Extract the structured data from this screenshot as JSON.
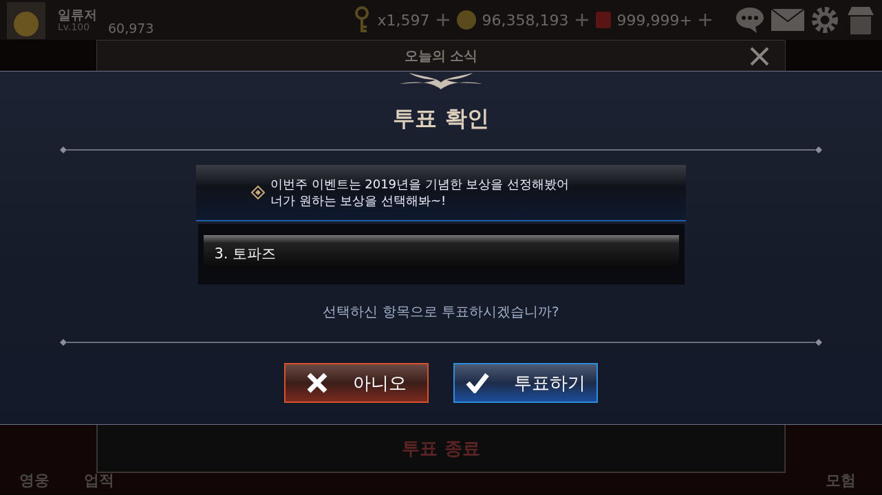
{
  "top_bar": {
    "player_name": "일류저",
    "level": "Lv.100",
    "score": "60,973",
    "keys": "x1,597",
    "coins": "96,358,193",
    "gems": "999,999+"
  },
  "news_panel": {
    "title": "오늘의 소식",
    "footer_button": "투표 종료"
  },
  "bottom_nav": [
    {
      "label": "영웅"
    },
    {
      "label": "업적"
    },
    {
      "label": "모험"
    }
  ],
  "dialog": {
    "title": "투표 확인",
    "message": [
      "이번주 이벤트는 2019년을 기념한 보상을 선정해봤어",
      "너가 원하는 보상을 선택해봐~!"
    ],
    "selected_option": "3. 토파즈",
    "question": "선택하신 항목으로 투표하시겠습니까?",
    "buttons": [
      {
        "label": "아니오",
        "kind": "cancel"
      },
      {
        "label": "투표하기",
        "kind": "confirm"
      }
    ]
  }
}
